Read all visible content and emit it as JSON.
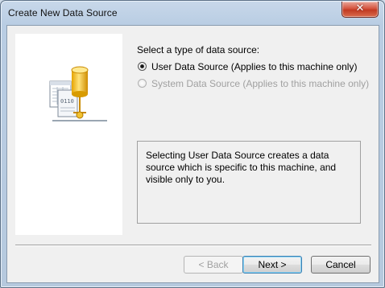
{
  "window": {
    "title": "Create New Data Source",
    "close_glyph": "✕"
  },
  "prompt": "Select a type of data source:",
  "options": [
    {
      "label": "User Data Source (Applies to this machine only)",
      "selected": true,
      "enabled": true
    },
    {
      "label": "System Data Source (Applies to this machine only)",
      "selected": false,
      "enabled": false
    }
  ],
  "graphic_text": "0110",
  "description": "Selecting User Data Source creates a data source which is specific to this machine, and visible only to you.",
  "buttons": {
    "back": "< Back",
    "next": "Next >",
    "cancel": "Cancel"
  }
}
